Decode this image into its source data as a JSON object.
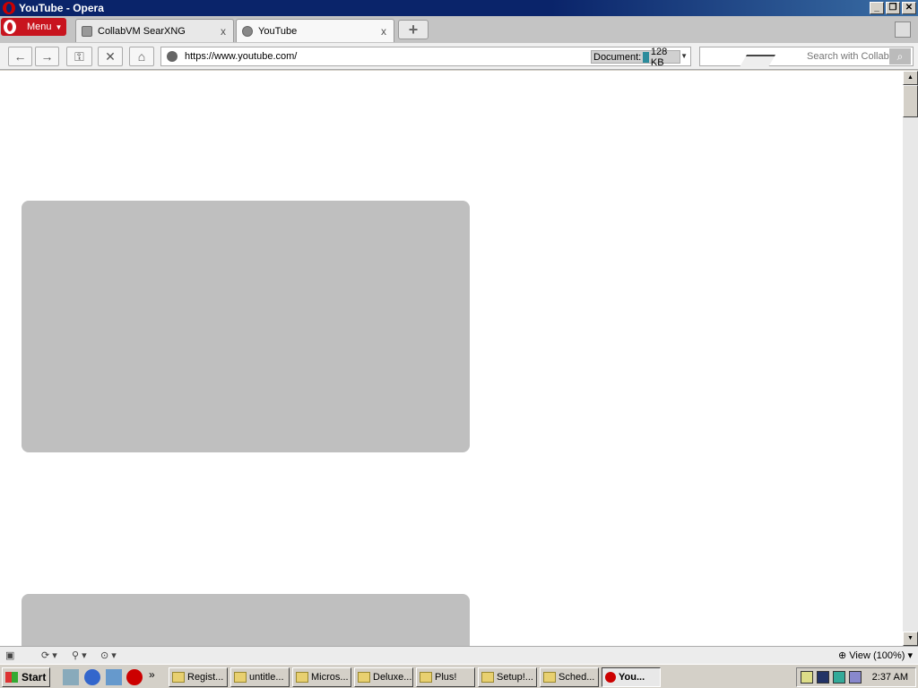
{
  "window": {
    "title": "YouTube - Opera"
  },
  "window_controls": {
    "minimize": "_",
    "maximize": "❐",
    "close": "✕"
  },
  "tabbar": {
    "menu_label": "Menu",
    "tabs": [
      {
        "label": "CollabVM SearXNG",
        "close": "x"
      },
      {
        "label": "YouTube",
        "close": "x"
      }
    ],
    "new_tab": "+"
  },
  "navbar": {
    "url": "https://www.youtube.com/",
    "progress_label": "Document:",
    "progress_size": "128 KB",
    "search_placeholder": "Search with Collab",
    "back": "←",
    "forward": "→",
    "key": "⚿",
    "stop": "✕",
    "home": "⌂"
  },
  "statusbar": {
    "zoom": "View (100%)"
  },
  "taskbar": {
    "start": "Start",
    "tasks": [
      "Regist...",
      "untitle...",
      "Micros...",
      "Deluxe...",
      "Plus!",
      "Setup!...",
      "Sched...",
      "You..."
    ],
    "clock": "2:37 AM",
    "chevron": "»"
  }
}
